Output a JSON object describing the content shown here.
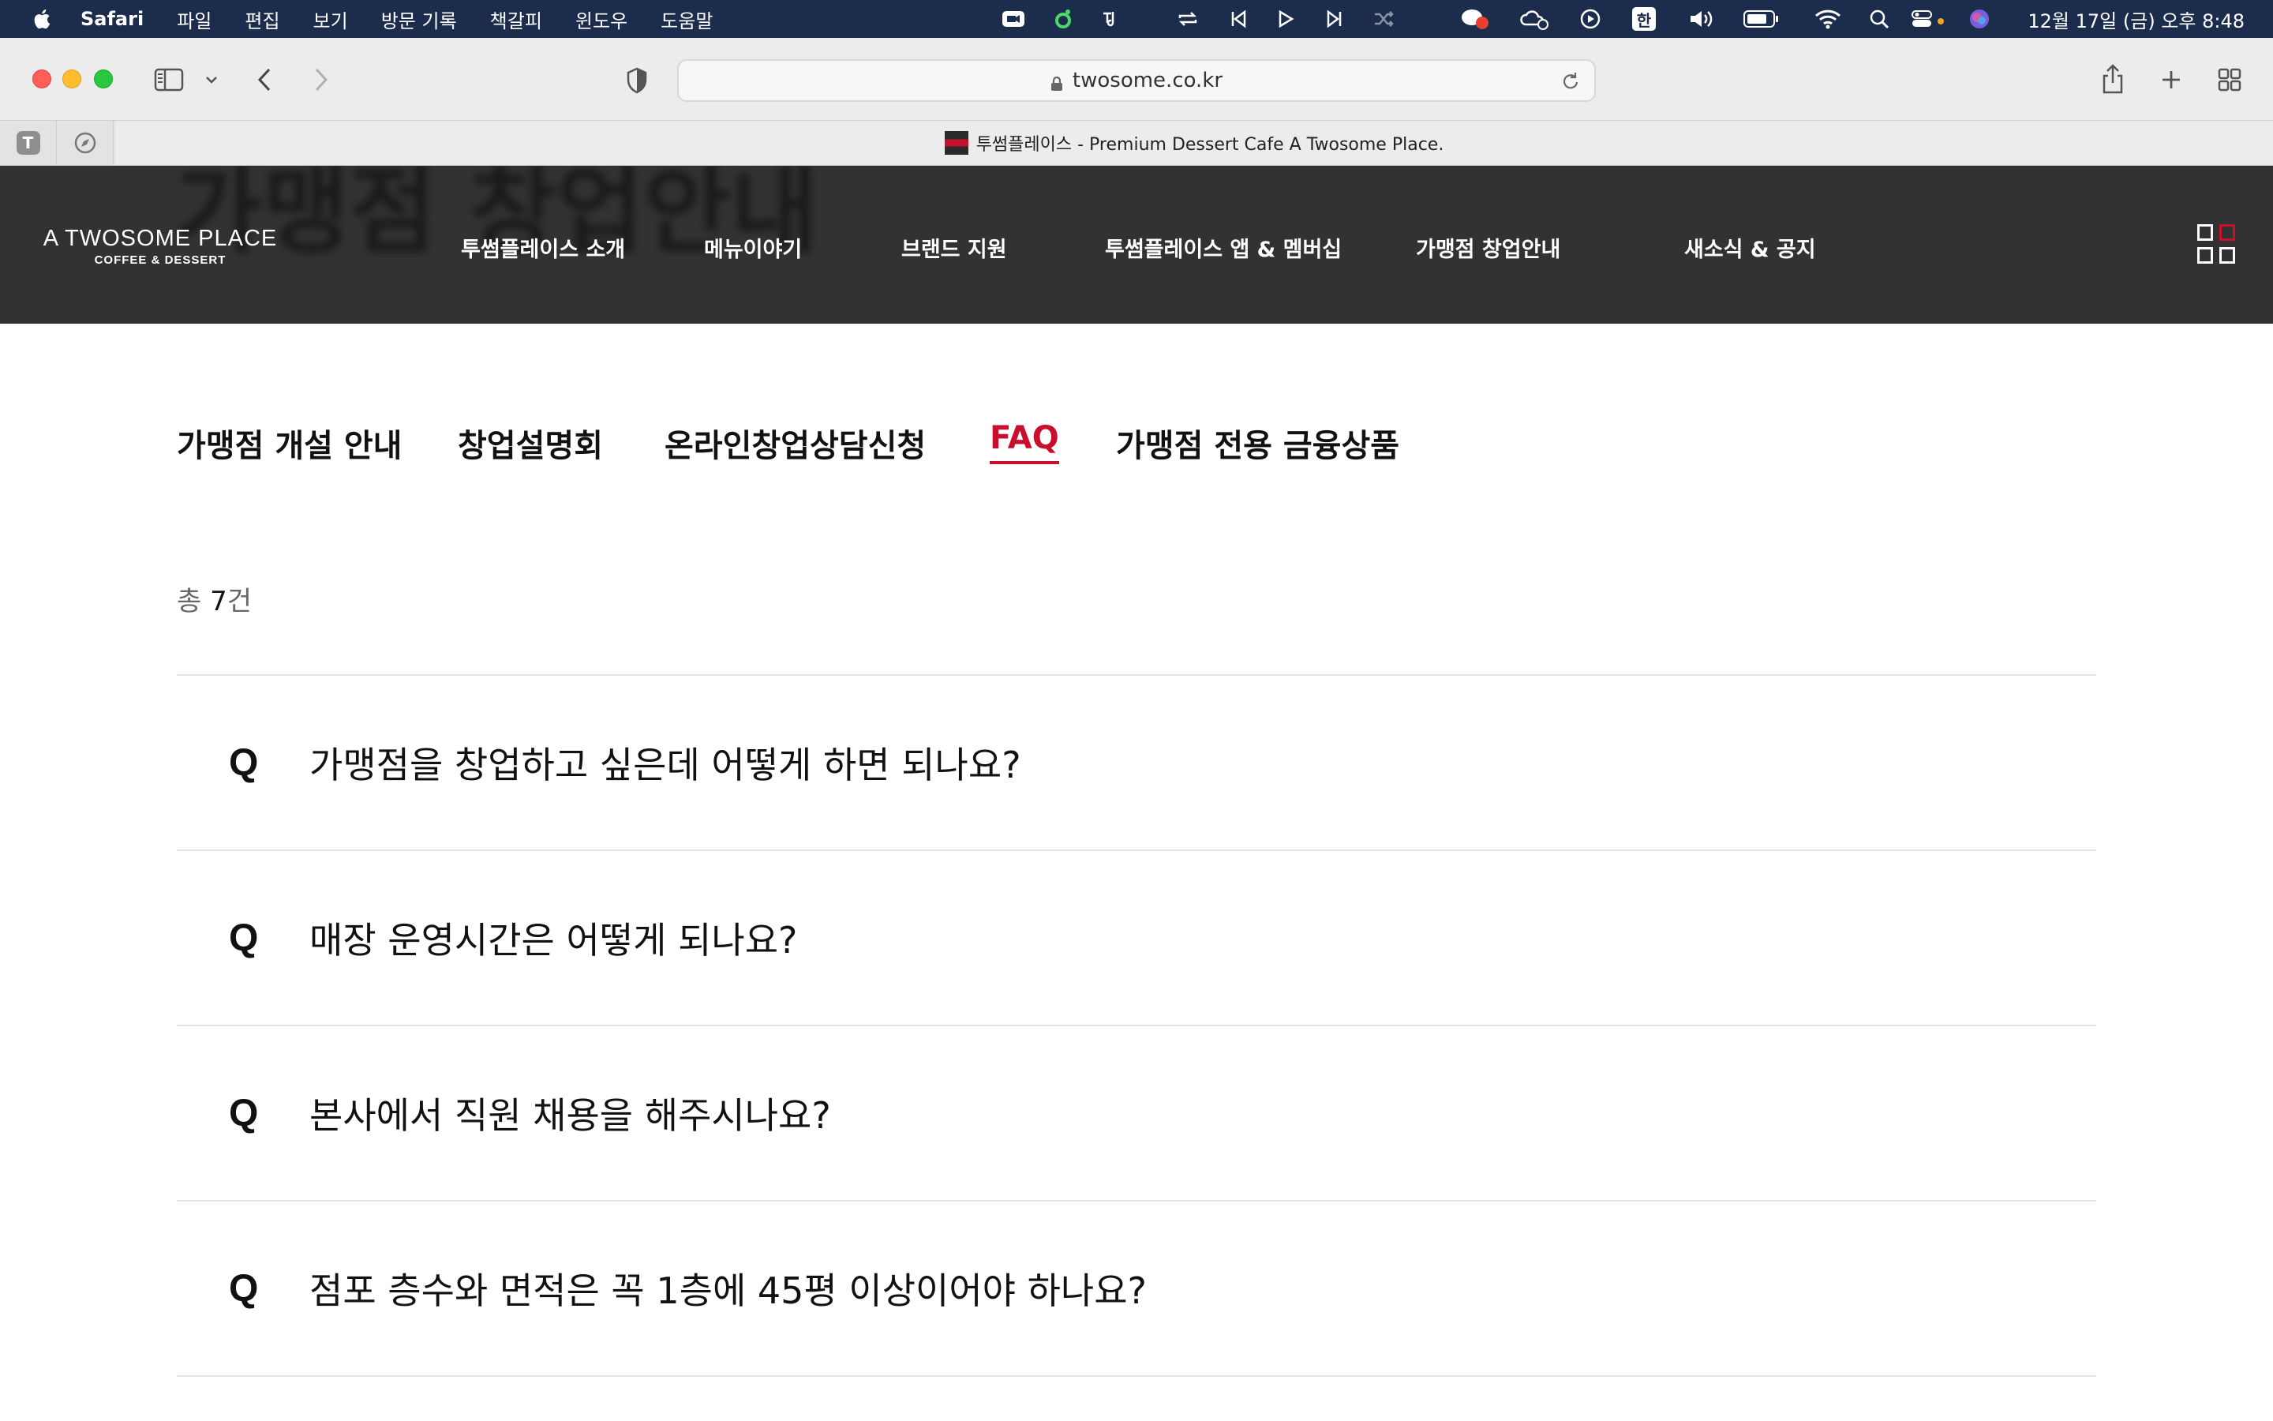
{
  "menubar": {
    "app_name": "Safari",
    "items": [
      "파일",
      "편집",
      "보기",
      "방문 기록",
      "책갈피",
      "윈도우",
      "도움말"
    ],
    "clock": "12월 17일 (금) 오후 8:48",
    "input_source": "한"
  },
  "browser": {
    "url": "twosome.co.kr",
    "tab_title": "투썸플레이스 - Premium Dessert Cafe A Twosome Place.",
    "pinned_tab_label": "T"
  },
  "site": {
    "logo_line1": "A TWOSOME PLACE",
    "logo_line2": "COFFEE & DESSERT",
    "ghost_heading": "가맹점 창업안내",
    "nav": [
      "투썸플레이스 소개",
      "메뉴이야기",
      "브랜드 지원",
      "투썸플레이스 앱 & 멤버십",
      "가맹점 창업안내",
      "새소식 & 공지"
    ],
    "accent_color": "#c8102e",
    "header_color": "#323232"
  },
  "subnav": {
    "tabs": [
      "가맹점 개설 안내",
      "창업설명회",
      "온라인창업상담신청",
      "FAQ",
      "가맹점 전용 금융상품"
    ],
    "active": "FAQ"
  },
  "faq": {
    "total_prefix": "총",
    "total_count": "7",
    "total_suffix": "건",
    "q_marker": "Q",
    "items": [
      "가맹점을 창업하고 싶은데 어떻게 하면 되나요?",
      "매장 운영시간은 어떻게 되나요?",
      "본사에서 직원 채용을 해주시나요?",
      "점포 층수와 면적은 꼭 1층에 45평 이상이어야 하나요?"
    ]
  }
}
